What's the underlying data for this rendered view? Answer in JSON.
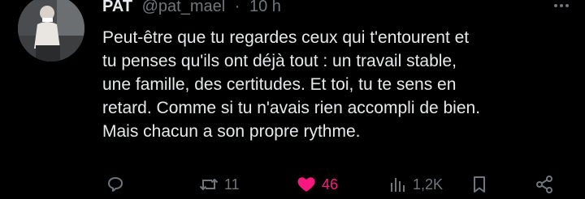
{
  "tweet": {
    "author_name": "PAT",
    "handle": "@pat_mael",
    "separator": "·",
    "time": "10 h",
    "text_lines": [
      "Peut-être que tu regardes ceux qui t'entourent et",
      "tu penses qu'ils ont déjà tout : un travail stable,",
      "une famille, des certitudes. Et toi, tu te sens en",
      "retard. Comme si tu n'avais rien accompli de bien.",
      "Mais chacun a son propre rythme."
    ]
  },
  "actions": {
    "retweets": "11",
    "likes": "46",
    "views": "1,2K"
  },
  "colors": {
    "background": "#000000",
    "text": "#e7e9ea",
    "muted": "#71767b",
    "like": "#f91880"
  },
  "icons": [
    "more-icon",
    "reply-icon",
    "retweet-icon",
    "heart-icon",
    "views-icon",
    "bookmark-icon",
    "share-icon"
  ]
}
